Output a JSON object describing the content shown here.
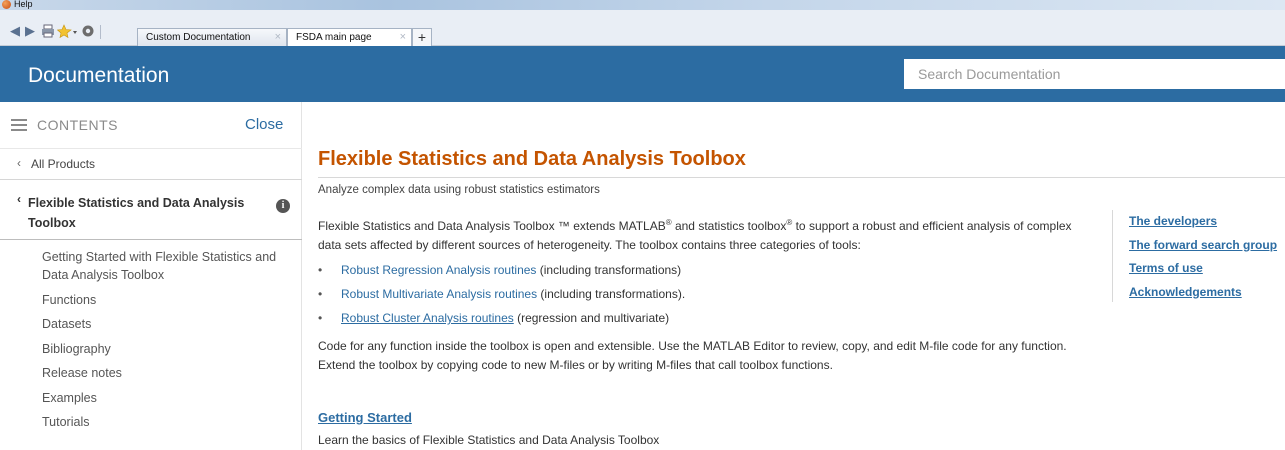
{
  "window": {
    "title": "Help"
  },
  "toolbar": {
    "icons": [
      "back-arrow-icon",
      "forward-arrow-icon",
      "print-icon",
      "favorites-star-icon",
      "settings-gear-icon"
    ],
    "tabs": [
      {
        "label": "Custom Documentation",
        "close": "×"
      },
      {
        "label": "FSDA main page",
        "close": "×"
      }
    ],
    "add_tab": "+"
  },
  "header": {
    "title": "Documentation",
    "search_placeholder": "Search Documentation"
  },
  "sidebar": {
    "contents_label": "CONTENTS",
    "close_label": "Close",
    "all_products": "All Products",
    "current_section": "Flexible Statistics and Data Analysis Toolbox",
    "info_glyph": "i",
    "items": [
      "Getting Started with Flexible Statistics and Data Analysis Toolbox",
      "Functions",
      "Datasets",
      "Bibliography",
      "Release notes",
      "Examples",
      "Tutorials"
    ]
  },
  "main": {
    "title": "Flexible Statistics and Data Analysis Toolbox",
    "subtitle": "Analyze complex data using robust statistics estimators",
    "intro": {
      "part1": "Flexible Statistics and Data Analysis Toolbox ™ extends MATLAB",
      "sup1": "®",
      "part2": " and statistics toolbox",
      "sup2": "®",
      "part3": " to support a robust and efficient analysis of complex data sets affected by different sources of heterogeneity. The toolbox contains three categories of tools:"
    },
    "bullets": [
      {
        "link": "Robust Regression Analysis routines",
        "rest": " (including transformations)"
      },
      {
        "link": "Robust Multivariate Analysis routines",
        "rest": " (including transformations)."
      },
      {
        "link": "Robust Cluster Analysis routines",
        "rest": " (regression and multivariate)"
      }
    ],
    "bullet_glyph": "•",
    "code_paragraph": "Code for any function inside the toolbox is open and extensible. Use the MATLAB Editor to review, copy, and edit M-file code for any function. Extend the toolbox by copying code to new M-files or by writing M-files that call toolbox functions.",
    "getting_started": {
      "title": "Getting Started",
      "description": "Learn the basics of Flexible Statistics and Data Analysis Toolbox"
    },
    "right_links": [
      "The developers",
      "The forward search group",
      "Terms of use",
      "Acknowledgements"
    ]
  },
  "colors": {
    "header_bg": "#2c6ca2",
    "title_orange": "#c45400",
    "link_blue": "#2c6ca2"
  }
}
